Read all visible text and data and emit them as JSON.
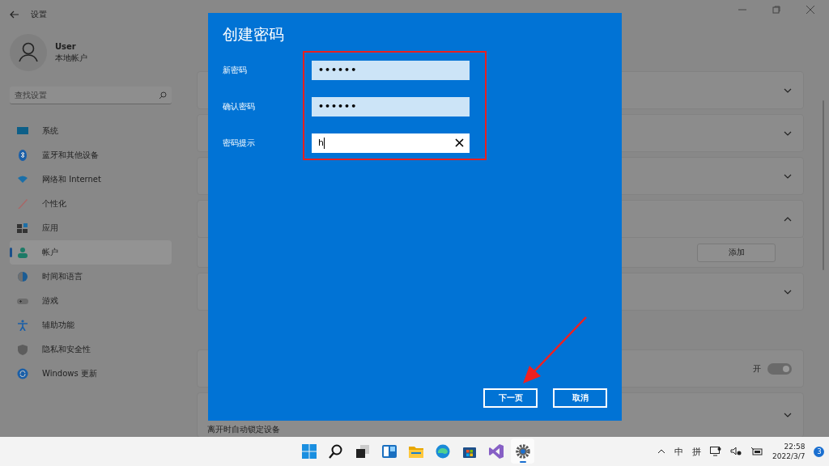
{
  "window": {
    "title": "设置"
  },
  "user": {
    "name": "User",
    "account_type": "本地帐户"
  },
  "search": {
    "placeholder": "查找设置"
  },
  "nav": [
    {
      "label": "系统",
      "kind": "system",
      "selected": false
    },
    {
      "label": "蓝牙和其他设备",
      "kind": "bluetooth",
      "selected": false
    },
    {
      "label": "网络和 Internet",
      "kind": "wifi",
      "selected": false
    },
    {
      "label": "个性化",
      "kind": "brush",
      "selected": false
    },
    {
      "label": "应用",
      "kind": "apps",
      "selected": false
    },
    {
      "label": "帐户",
      "kind": "person",
      "selected": true
    },
    {
      "label": "时间和语言",
      "kind": "globe",
      "selected": false
    },
    {
      "label": "游戏",
      "kind": "gamepad",
      "selected": false
    },
    {
      "label": "辅助功能",
      "kind": "accessibility",
      "selected": false
    },
    {
      "label": "隐私和安全性",
      "kind": "shield",
      "selected": false
    },
    {
      "label": "Windows 更新",
      "kind": "update",
      "selected": false
    }
  ],
  "cards": [
    {
      "kind": "expander",
      "expanded": false
    },
    {
      "kind": "expander",
      "expanded": false
    },
    {
      "kind": "expander",
      "expanded": false
    },
    {
      "kind": "expander",
      "expanded": true,
      "button": "添加"
    },
    {
      "kind": "expander",
      "expanded": false
    }
  ],
  "other_cards": [
    {
      "kind": "toggle",
      "state_label": "开",
      "on": true
    },
    {
      "kind": "expander",
      "expanded": false,
      "description": "离开时自动锁定设备"
    }
  ],
  "dialog": {
    "title": "创建密码",
    "fields": [
      {
        "label": "新密码",
        "value": "••••••",
        "kind": "password"
      },
      {
        "label": "确认密码",
        "value": "••••••",
        "kind": "password"
      },
      {
        "label": "密码提示",
        "value": "h",
        "kind": "text"
      }
    ],
    "buttons": [
      "下一页",
      "取消"
    ]
  },
  "taskbar": {
    "apps": [
      {
        "kind": "start",
        "active": false
      },
      {
        "kind": "search",
        "active": false
      },
      {
        "kind": "taskview",
        "active": false
      },
      {
        "kind": "widgets",
        "active": false
      },
      {
        "kind": "folder",
        "active": false
      },
      {
        "kind": "edge",
        "active": false
      },
      {
        "kind": "store",
        "active": false
      },
      {
        "kind": "vs",
        "active": false
      },
      {
        "kind": "settings",
        "active": true
      }
    ],
    "ime_mode": "中",
    "ime_name": "拼",
    "time": "22:58",
    "date": "2022/3/7",
    "notifications": "3"
  }
}
